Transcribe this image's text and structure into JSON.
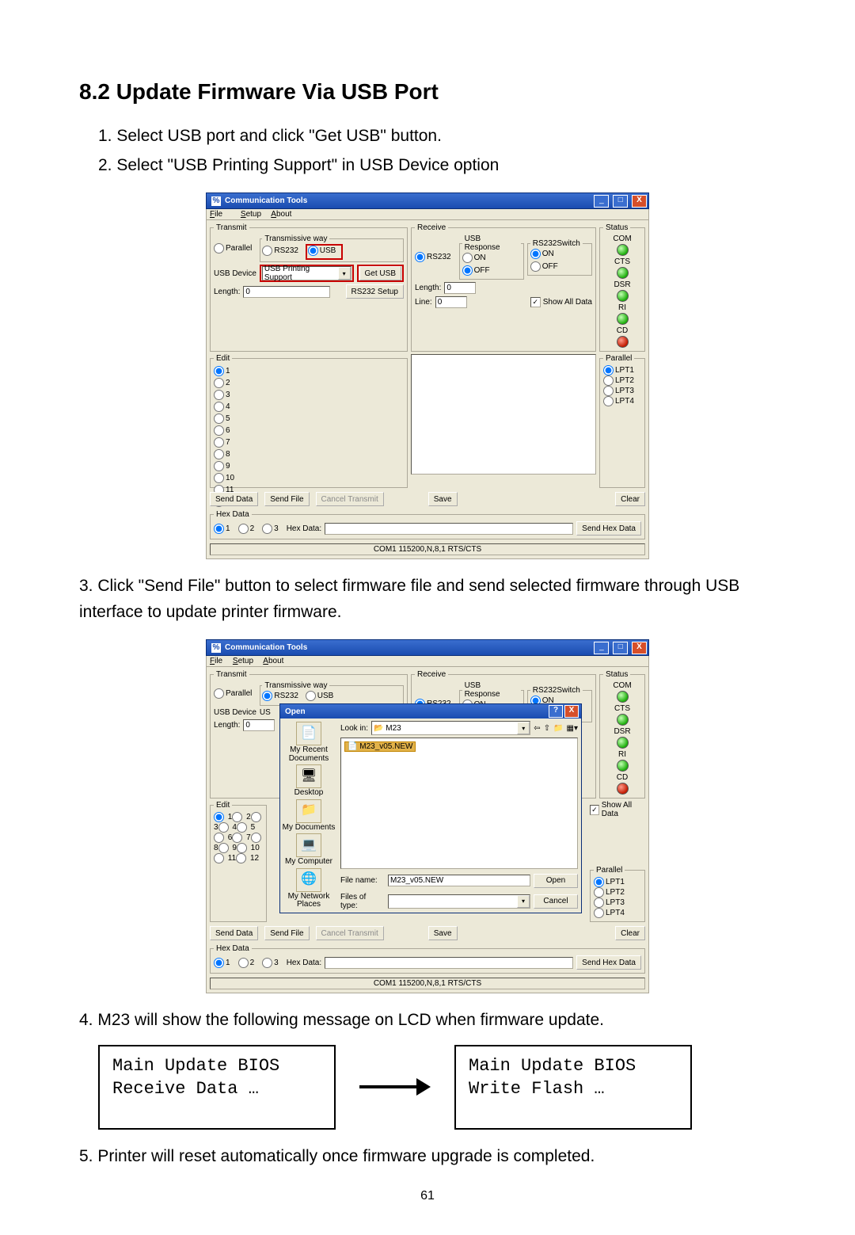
{
  "heading": "8.2 Update Firmware Via USB Port",
  "steps": {
    "s1": "1. Select USB port and click \"Get USB\" button.",
    "s2": "2. Select \"USB Printing Support\" in USB Device option",
    "s3": "3. Click \"Send File\" button to select firmware file and send selected firmware through USB interface to update printer firmware.",
    "s4": "4. M23 will show the following message on LCD when firmware update.",
    "s5": "5. Printer will reset automatically once firmware upgrade is completed."
  },
  "page_number": "61",
  "win": {
    "title": "Communication Tools",
    "menu": {
      "file": "File",
      "setup": "Setup",
      "about": "About"
    },
    "groups": {
      "transmit": "Transmit",
      "transmissive_way": "Transmissive way",
      "receive": "Receive",
      "usb_response": "USB Response",
      "rs232_switch": "RS232Switch",
      "status": "Status",
      "parallel": "Parallel",
      "edit": "Edit",
      "hex_data": "Hex Data"
    },
    "radios": {
      "parallel": "Parallel",
      "rs232": "RS232",
      "usb": "USB",
      "on": "ON",
      "off": "OFF",
      "lpt1": "LPT1",
      "lpt2": "LPT2",
      "lpt3": "LPT3",
      "lpt4": "LPT4"
    },
    "labels": {
      "usb_device": "USB Device",
      "length": "Length:",
      "line": "Line:",
      "hexdata_lbl": "Hex Data:",
      "lookin": "Look in:",
      "filename": "File name:",
      "filetype": "Files of type:"
    },
    "values": {
      "usb_device": "USB Printing Support",
      "length_tx": "0",
      "length_rx": "0",
      "line_rx": "0",
      "lookin_folder": "M23",
      "selected_file": "M23_v05.NEW",
      "file_name_input": "M23_v05.NEW"
    },
    "buttons": {
      "get_usb": "Get USB",
      "rs232_setup": "RS232 Setup",
      "send_data": "Send Data",
      "send_file": "Send File",
      "cancel_transmit": "Cancel Transmit",
      "save": "Save",
      "clear": "Clear",
      "send_hex": "Send Hex Data",
      "open": "Open",
      "cancel": "Cancel"
    },
    "check": {
      "show_all": "Show All Data"
    },
    "status_items": [
      "COM",
      "CTS",
      "DSR",
      "RI",
      "CD"
    ],
    "edit_count": 12,
    "statusbar": "COM1 115200,N,8,1 RTS/CTS",
    "open_dialog_title": "Open",
    "places": [
      "My Recent Documents",
      "Desktop",
      "My Documents",
      "My Computer",
      "My Network Places"
    ]
  },
  "lcd": {
    "left1": "Main Update BIOS",
    "left2": "Receive Data …",
    "right1": "Main Update BIOS",
    "right2": "Write Flash …"
  },
  "chart_data": null
}
